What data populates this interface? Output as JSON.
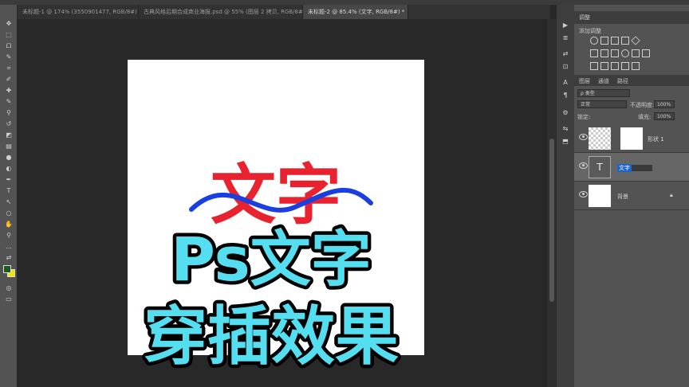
{
  "tabs": [
    {
      "label": "未标题-1 @ 174% (3550901477, RGB/8#) *",
      "close": "×"
    },
    {
      "label": "古典风格后期合成商业海报.psd @ 55% (图层 2 拷贝, RGB/8#) *",
      "close": "×"
    },
    {
      "label": "未标题-2 @ 85.4% (文字, RGB/8#) *",
      "close": "×"
    }
  ],
  "toolbar": {
    "tools": [
      "move-icon",
      "marquee-icon",
      "lasso-icon",
      "quick-select-icon",
      "crop-icon",
      "eyedropper-icon",
      "healing-icon",
      "brush-icon",
      "stamp-icon",
      "history-brush-icon",
      "eraser-icon",
      "gradient-icon",
      "blur-icon",
      "dodge-icon",
      "pen-icon",
      "type-icon",
      "path-select-icon",
      "shape-icon",
      "hand-icon",
      "zoom-icon",
      "more-icon",
      "swap-colors-icon"
    ],
    "glyphs": [
      "✥",
      "⬚",
      "ᗝ",
      "✎",
      "⌗",
      "✐",
      "✚",
      "✎",
      "⚲",
      "↺",
      "◩",
      "▤",
      "●",
      "◐",
      "✒",
      "T",
      "↖",
      "○",
      "✋",
      "⚲",
      "…",
      "⇄"
    ],
    "foreground_color": "#1f5a1f",
    "background_color": "#f2e600"
  },
  "canvas": {
    "title_chars": "文字",
    "title_color": "#e8232f",
    "wave_color": "#1a3fe0",
    "overlay_line1": "Ps文字",
    "overlay_line2": "穿插效果",
    "overlay_fill": "#55ddf0",
    "overlay_stroke": "#000000"
  },
  "adjustments": {
    "tab": "调整",
    "add_label": "添加调整"
  },
  "layers_panel": {
    "tabs": [
      "图层",
      "通道",
      "路径"
    ],
    "filter_label": "ρ 类型",
    "blend_mode": "正常",
    "opacity_label": "不透明度:",
    "opacity_value": "100%",
    "lock_label": "锁定:",
    "fill_label": "填充:",
    "fill_value": "100%",
    "layers": [
      {
        "name": "形状 1",
        "type": "shape"
      },
      {
        "name": "文字",
        "type": "text",
        "selected": true
      },
      {
        "name": "背景",
        "type": "background"
      }
    ]
  },
  "icon_strip": {
    "glyphs": [
      "▶",
      "≣",
      "⇄",
      "⊡",
      "A",
      "¶",
      "⚙",
      "⇆",
      "⬒"
    ]
  }
}
